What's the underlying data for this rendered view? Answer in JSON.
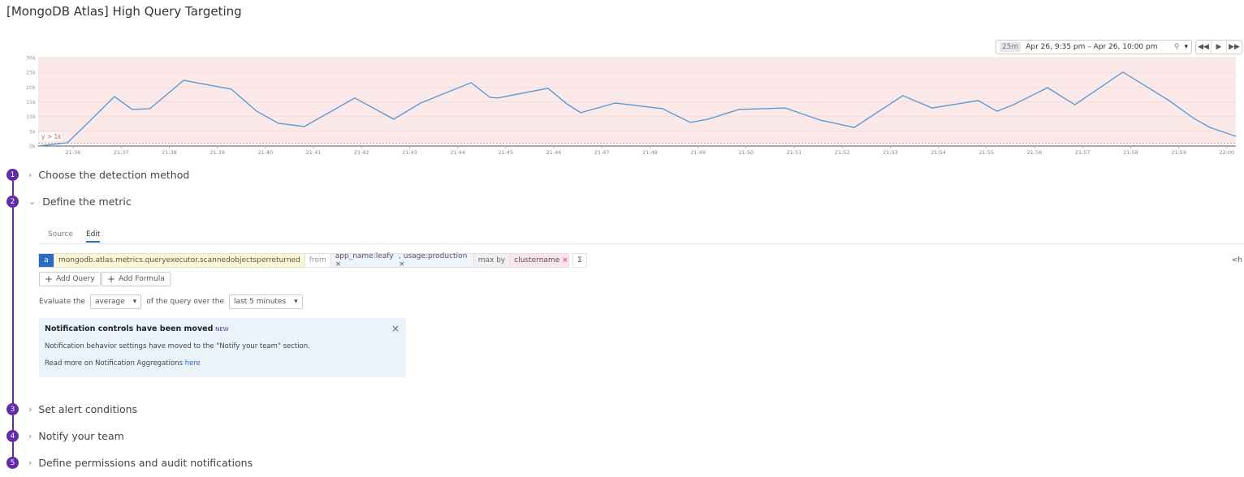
{
  "title": "[MongoDB Atlas] High Query Targeting",
  "timeframe": {
    "badge": "25m",
    "range": "Apr 26, 9:35 pm – Apr 26, 10:00 pm",
    "pin": "⚲",
    "dropdown": "▾"
  },
  "nav": {
    "back": "◀◀",
    "play": "▶",
    "forward": "▶▶"
  },
  "chart_data": {
    "type": "line",
    "title": "",
    "threshold_label": "y > 1k",
    "threshold": 1000,
    "ylim": [
      0,
      30000
    ],
    "yticks": [
      "0k",
      "5k",
      "10k",
      "15k",
      "20k",
      "25k",
      "30k"
    ],
    "xticks": [
      "21:36",
      "21:37",
      "21:38",
      "21:39",
      "21:40",
      "21:41",
      "21:42",
      "21:43",
      "21:44",
      "21:45",
      "21:46",
      "21:47",
      "21:48",
      "21:49",
      "21:50",
      "21:51",
      "21:52",
      "21:53",
      "21:54",
      "21:55",
      "21:56",
      "21:57",
      "21:58",
      "21:59",
      "22:00"
    ],
    "x_minutes_after_2135": [
      0.27,
      0.88,
      1.25,
      1.86,
      2.23,
      2.6,
      3.3,
      4.29,
      4.82,
      5.27,
      5.81,
      6.86,
      7.67,
      8.23,
      9.28,
      9.67,
      9.83,
      10.88,
      11.27,
      11.56,
      12.28,
      13.26,
      13.84,
      14.21,
      14.85,
      15.81,
      16.54,
      17.25,
      18.26,
      18.87,
      19.83,
      20.22,
      20.56,
      21.27,
      21.84,
      22.84,
      23.8,
      24.31,
      24.65,
      25.19
    ],
    "values": [
      0,
      1100,
      6900,
      16800,
      12400,
      12700,
      22300,
      19300,
      11800,
      7700,
      6600,
      16300,
      9100,
      14600,
      21500,
      16500,
      16300,
      19600,
      14300,
      11300,
      14600,
      12700,
      8000,
      9100,
      12400,
      12900,
      8800,
      6300,
      17100,
      12900,
      15400,
      11800,
      14000,
      19800,
      14000,
      25100,
      15400,
      9400,
      6300,
      3300
    ],
    "line_color": "#5b9bd5",
    "band_color": "#fbe9ea"
  },
  "steps": [
    {
      "num": "1",
      "label": "Choose the detection method"
    },
    {
      "num": "2",
      "label": "Define the metric"
    },
    {
      "num": "3",
      "label": "Set alert conditions"
    },
    {
      "num": "4",
      "label": "Notify your team"
    },
    {
      "num": "5",
      "label": "Define permissions and audit notifications"
    }
  ],
  "tabs": {
    "source": "Source",
    "edit": "Edit"
  },
  "query": {
    "letter": "a",
    "metric": "mongodb.atlas.metrics.queryexecutor.scannedobjectsperreturned",
    "from": "from",
    "tag1": "app_name:leafy ×",
    "tag2": ", usage:production ×",
    "agg": "max by",
    "group": "clustername",
    "group_x": "×",
    "sigma": "Σ",
    "lt": "<h"
  },
  "buttons": {
    "add_query": "Add Query",
    "add_formula": "Add Formula",
    "plus": "+"
  },
  "evaluate": {
    "prefix": "Evaluate the",
    "agg": "average",
    "middle": "of the query over the",
    "window": "last 5 minutes",
    "caret": "▾"
  },
  "notice": {
    "title": "Notification controls have been moved",
    "badge": "NEW",
    "body": "Notification behavior settings have moved to the \"Notify your team\" section.",
    "more": "Read more on Notification Aggregations",
    "link": "here",
    "close": "×"
  }
}
